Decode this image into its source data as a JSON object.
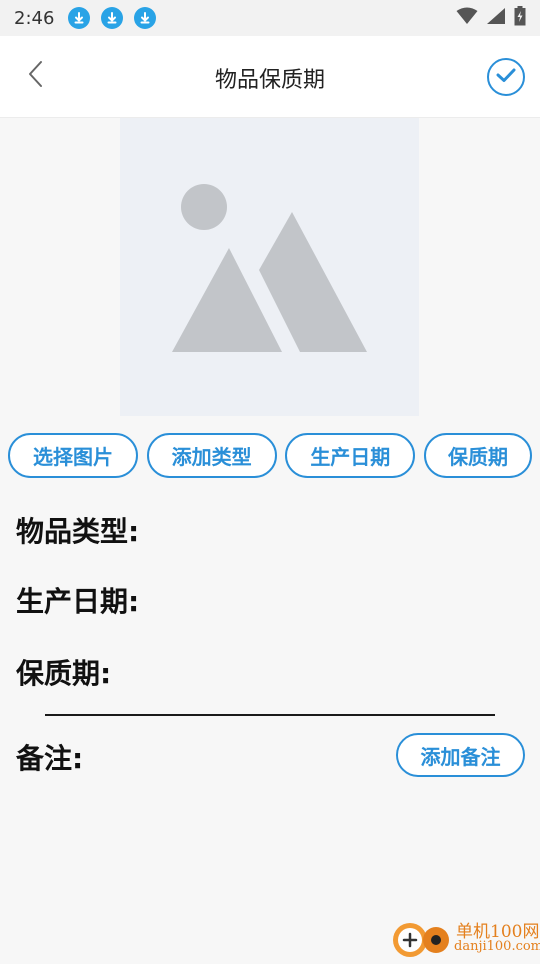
{
  "status_bar": {
    "time": "2:46",
    "icons": [
      "download-icon",
      "download-icon",
      "download-icon",
      "wifi-icon",
      "signal-icon",
      "battery-icon"
    ]
  },
  "header": {
    "title": "物品保质期",
    "back_icon": "chevron-left-icon",
    "confirm_icon": "check-circle-icon"
  },
  "image": {
    "icon": "image-placeholder-icon"
  },
  "buttons": {
    "select_image": "选择图片",
    "add_type": "添加类型",
    "production_date": "生产日期",
    "shelf_life": "保质期"
  },
  "fields": {
    "item_type": "物品类型:",
    "production_date": "生产日期:",
    "shelf_life": "保质期:",
    "note": "备注:"
  },
  "add_note_button": "添加备注",
  "watermark": {
    "name": "单机100网",
    "url": "danji100.com"
  },
  "colors": {
    "accent": "#2a8fd8",
    "placeholder_bg": "#edf0f5",
    "placeholder_shape": "#c2c5c9",
    "watermark": "#e4801e"
  }
}
